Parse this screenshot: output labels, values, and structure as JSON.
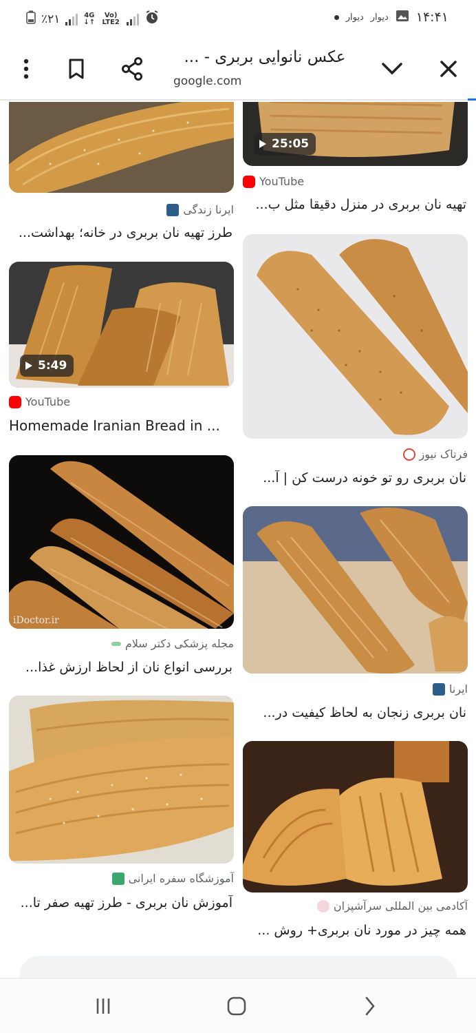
{
  "status_bar": {
    "time": "۱۴:۴۱",
    "notification_labels": [
      "دیوار",
      "دیوار"
    ],
    "battery_percent": "٪۲۱",
    "network_4g": "4G",
    "network_lte": "Vo) LTE2"
  },
  "browser": {
    "title": "عکس نانوایی بربری - ...",
    "url": "google.com",
    "icons": {
      "close": "close-icon",
      "collapse": "chevron-down-icon",
      "share": "share-icon",
      "bookmark": "bookmark-icon",
      "menu": "more-vert-icon"
    },
    "accent_color": "#1a73e8"
  },
  "results": {
    "left": [
      {
        "source": "ایرنا زندگی",
        "caption": "طرز تهیه نان بربری در خانه؛ بهداشت..."
      },
      {
        "source": "YouTube",
        "caption": "Homemade Iranian Bread in ...",
        "duration": "5:49"
      },
      {
        "source": "مجله پزشکی دکتر سلام",
        "caption": "بررسی انواع نان از لحاظ ارزش غذا...",
        "watermark": "iDoctor.ir"
      },
      {
        "source": "آموزشگاه سفره ایرانی",
        "caption": "آموزش نان بربری - طرز تهیه صفر تا..."
      }
    ],
    "right": [
      {
        "source": "YouTube",
        "caption": "تهیه نان بربری در منزل دقیقا مثل ب...",
        "duration": "25:05"
      },
      {
        "source": "فرتاک نیوز",
        "caption": "نان بربری رو تو خونه درست کن | آ..."
      },
      {
        "source": "ایرنا",
        "caption": "نان بربری زنجان به لحاظ کیفیت در..."
      },
      {
        "source": "آکادمی بین المللی سرآشپزان",
        "caption": "همه چیز در مورد نان بربری+ روش ..."
      }
    ]
  },
  "nav": {
    "recent": "recent-apps-icon",
    "home": "home-icon",
    "back": "back-icon"
  }
}
